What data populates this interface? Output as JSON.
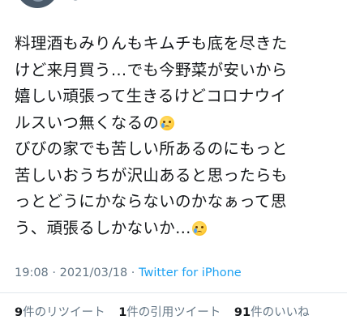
{
  "author": {
    "handle_fragment": "@..."
  },
  "tweet": {
    "lines": [
      "料理酒もみりんもキムチも底を尽きた",
      "けど来月買う…でも今野菜が安いから",
      "嬉しい頑張って生きるけどコロナウイ",
      "ルスいつ無くなるの",
      "びびの家でも苦しい所あるのにもっと",
      "苦しいおうちが沢山あると思ったらも",
      "っとどうにかならないのかなぁって思",
      "う、頑張るしかないか…"
    ],
    "emoji_name": "crying-face"
  },
  "meta": {
    "time": "19:08",
    "sep1": " · ",
    "date": "2021/03/18",
    "sep2": " · ",
    "source": "Twitter for iPhone"
  },
  "stats": {
    "retweets_count": "9",
    "retweets_label": "件のリツイート",
    "quotes_count": "1",
    "quotes_label": "件の引用ツイート",
    "likes_count": "91",
    "likes_label": "件のいいね"
  },
  "colors": {
    "text": "#14171a",
    "secondary": "#657786",
    "link": "#1da1f2",
    "divider": "#e1e8ed"
  }
}
